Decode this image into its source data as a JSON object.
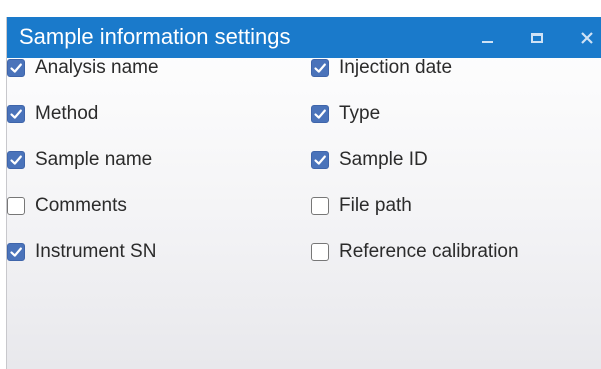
{
  "window": {
    "title": "Sample information settings",
    "title_bar_color": "#1a7acb",
    "controls": [
      "minimize-icon",
      "maximize-icon",
      "close-icon"
    ]
  },
  "checkbox_color": "#4a73ba",
  "options": [
    {
      "label": "Analysis name",
      "checked": true
    },
    {
      "label": "Injection date",
      "checked": true
    },
    {
      "label": "Method",
      "checked": true
    },
    {
      "label": "Type",
      "checked": true
    },
    {
      "label": "Sample name",
      "checked": true
    },
    {
      "label": "Sample ID",
      "checked": true
    },
    {
      "label": "Comments",
      "checked": false
    },
    {
      "label": "File path",
      "checked": false
    },
    {
      "label": "Instrument SN",
      "checked": true
    },
    {
      "label": "Reference calibration",
      "checked": false
    }
  ]
}
